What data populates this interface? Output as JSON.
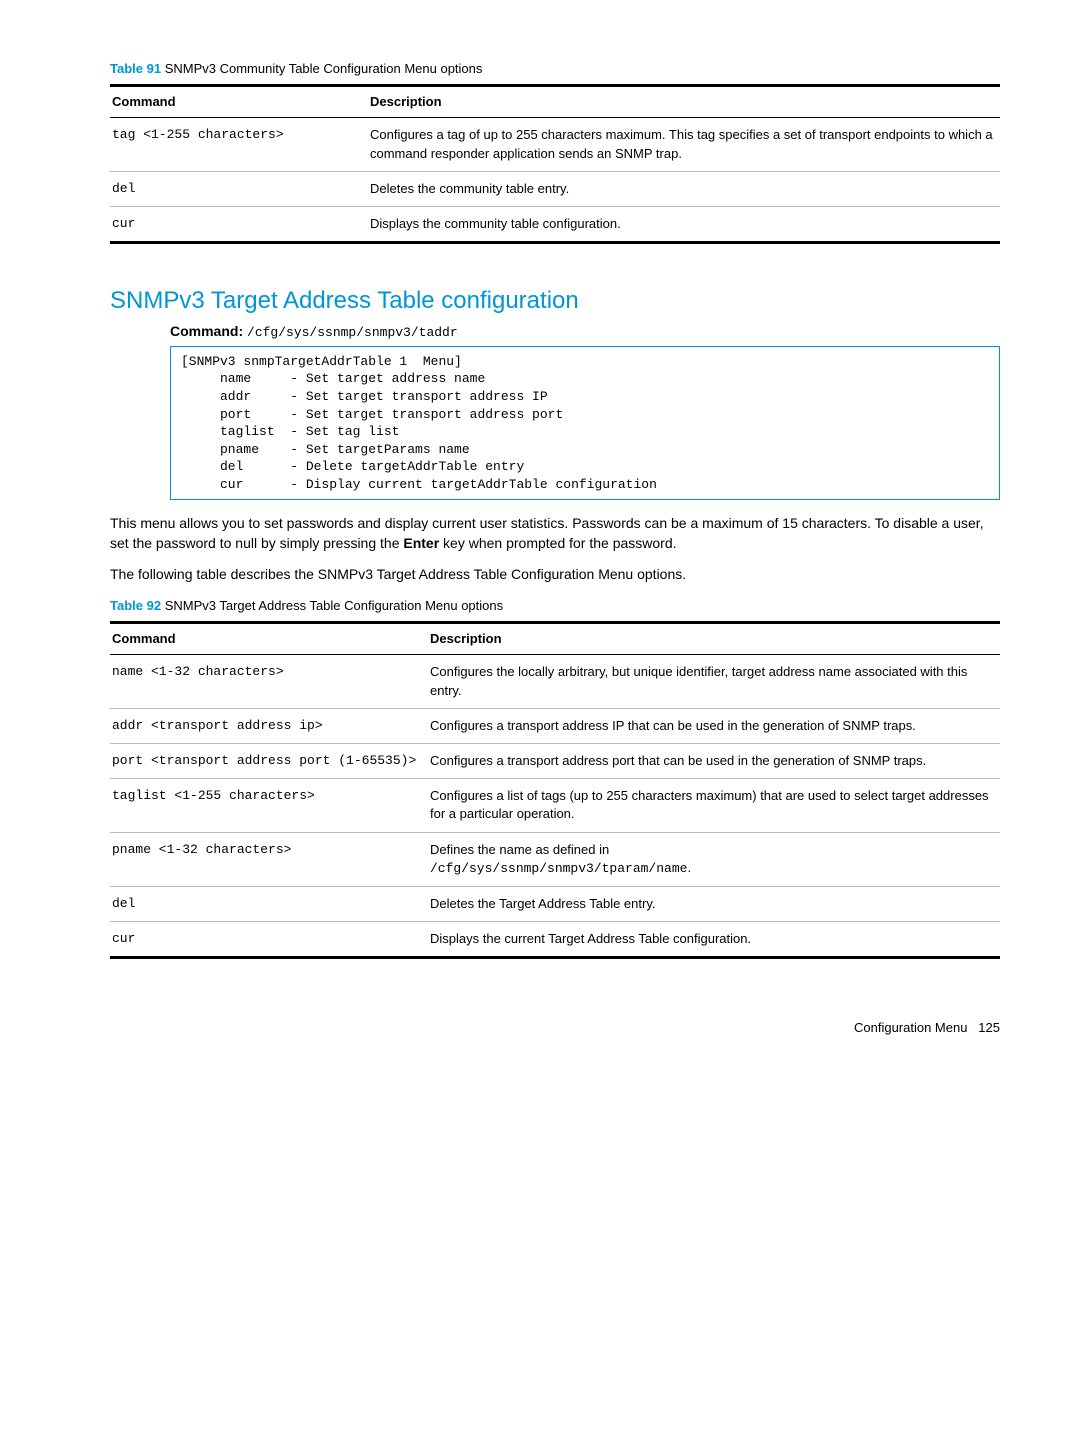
{
  "table91": {
    "caption_label": "Table 91",
    "caption_text": "SNMPv3 Community Table Configuration Menu options",
    "head_cmd": "Command",
    "head_desc": "Description",
    "rows": [
      {
        "cmd": "tag <1-255 characters>",
        "desc": "Configures a tag of up to 255 characters maximum. This tag specifies a set of transport endpoints to which a command responder application sends an SNMP trap."
      },
      {
        "cmd": "del",
        "desc": "Deletes the community table entry."
      },
      {
        "cmd": "cur",
        "desc": "Displays the community table configuration."
      }
    ]
  },
  "heading": "SNMPv3 Target Address Table configuration",
  "cmd_label": "Command:",
  "cmd_path": "/cfg/sys/ssnmp/snmpv3/taddr",
  "codebox": "[SNMPv3 snmpTargetAddrTable 1  Menu]\n     name     - Set target address name\n     addr     - Set target transport address IP\n     port     - Set target transport address port\n     taglist  - Set tag list\n     pname    - Set targetParams name\n     del      - Delete targetAddrTable entry\n     cur      - Display current targetAddrTable configuration",
  "para1_pre": "This menu allows you to set passwords and display current user statistics. Passwords can be a maximum of 15 characters. To disable a user, set the password to null by simply pressing the ",
  "para1_bold": "Enter",
  "para1_post": " key when prompted for the password.",
  "para2": "The following table describes the SNMPv3 Target Address Table Configuration Menu options.",
  "table92": {
    "caption_label": "Table 92",
    "caption_text": "SNMPv3 Target Address Table Configuration Menu options",
    "head_cmd": "Command",
    "head_desc": "Description",
    "rows": [
      {
        "cmd": "name <1-32 characters>",
        "desc": "Configures the locally arbitrary, but unique identifier, target address name associated with this entry."
      },
      {
        "cmd": "addr <transport address ip>",
        "desc": "Configures a transport address IP that can be used in the generation of SNMP traps."
      },
      {
        "cmd": "port <transport address port (1-65535)>",
        "desc": "Configures a transport address port that can be used in the generation of SNMP traps."
      },
      {
        "cmd": "taglist <1-255 characters>",
        "desc": "Configures a list of tags (up to 255 characters maximum) that are used to select target addresses for a particular operation."
      },
      {
        "cmd": "pname <1-32 characters>",
        "desc_pre": "Defines the name as defined in ",
        "desc_mono": "/cfg/sys/ssnmp/snmpv3/tparam/name",
        "desc_post": "."
      },
      {
        "cmd": "del",
        "desc": "Deletes the Target Address Table entry."
      },
      {
        "cmd": "cur",
        "desc": "Displays the current Target Address Table configuration."
      }
    ]
  },
  "footer_text": "Configuration Menu",
  "footer_page": "125"
}
